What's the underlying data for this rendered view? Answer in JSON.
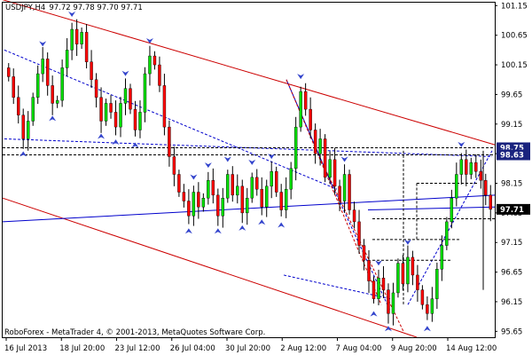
{
  "chart_data": {
    "type": "candlestick",
    "symbol_label": "USDJPY,H4",
    "ohlc_label": "97.72 97.78 97.70 97.71",
    "footer": "RoboForex - MetaTrader 4, © 2001-2013, MetaQuotes Software Corp.",
    "ylim": [
      95.55,
      101.2
    ],
    "y_ticks": [
      "101.15",
      "100.65",
      "100.15",
      "99.65",
      "99.15",
      "98.65",
      "98.15",
      "97.65",
      "97.15",
      "96.65",
      "96.15",
      "95.65"
    ],
    "x_ticks": [
      "16 Jul 2013",
      "18 Jul 20:00",
      "23 Jul 12:00",
      "26 Jul 04:00",
      "30 Jul 20:00",
      "2 Aug 12:00",
      "7 Aug 04:00",
      "9 Aug 20:00",
      "14 Aug 12:00"
    ],
    "price_tags": [
      {
        "label": "98.75",
        "bg": "#1a237e",
        "fg": "#ffffff"
      },
      {
        "label": "98.63",
        "bg": "#1a237e",
        "fg": "#ffffff"
      },
      {
        "label": "97.71",
        "bg": "#000000",
        "fg": "#ffffff"
      }
    ],
    "colors": {
      "bull": "#00dd00",
      "bear": "#ff0000",
      "channel": "#cc0000",
      "trend": "#0000cc",
      "text": "#000000",
      "arrow": "#3344cc"
    },
    "closes": [
      99.95,
      99.6,
      99.3,
      98.9,
      99.2,
      99.6,
      100.0,
      100.25,
      99.8,
      99.5,
      99.55,
      100.1,
      100.4,
      100.75,
      100.5,
      100.7,
      100.2,
      99.9,
      99.6,
      99.2,
      99.5,
      99.35,
      99.1,
      99.5,
      99.75,
      99.4,
      99.05,
      99.35,
      100.0,
      100.3,
      100.15,
      99.8,
      99.1,
      98.6,
      98.3,
      98.0,
      97.85,
      97.6,
      98.0,
      97.75,
      97.9,
      98.2,
      97.95,
      97.6,
      97.9,
      98.3,
      97.95,
      98.1,
      97.65,
      97.9,
      98.25,
      98.05,
      97.75,
      98.1,
      98.35,
      98.0,
      97.7,
      98.05,
      98.4,
      99.1,
      99.7,
      99.4,
      99.05,
      98.65,
      98.9,
      98.25,
      98.55,
      98.1,
      97.85,
      98.3,
      97.7,
      97.5,
      97.1,
      96.85,
      96.5,
      96.2,
      96.55,
      96.35,
      95.95,
      96.3,
      96.8,
      96.45,
      96.9,
      96.6,
      96.35,
      96.1,
      95.95,
      96.2,
      96.7,
      97.1,
      97.5,
      97.9,
      98.3,
      98.55,
      98.3,
      98.5,
      98.35,
      98.2,
      97.95,
      97.71
    ]
  }
}
